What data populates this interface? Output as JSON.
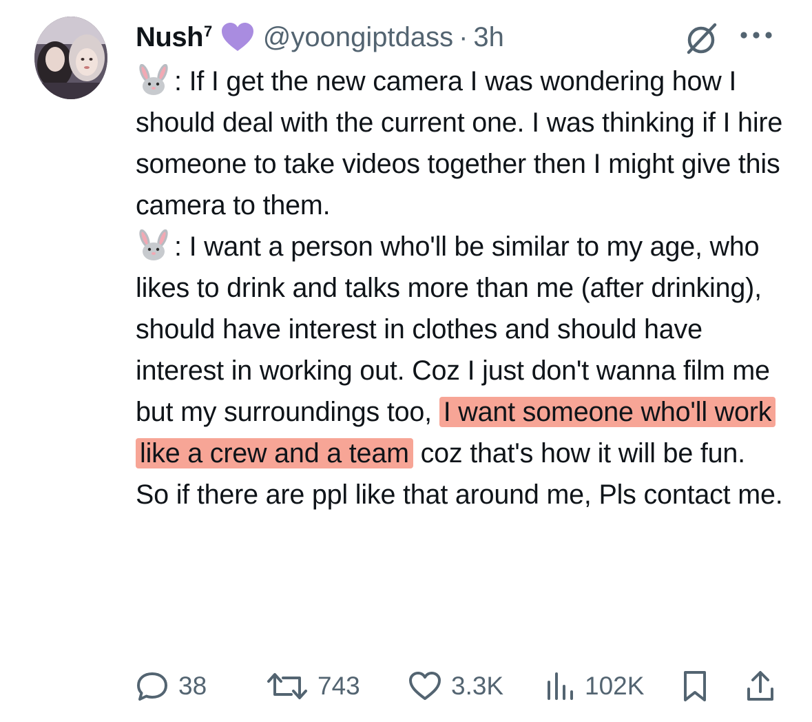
{
  "author": {
    "display_name": "Nush",
    "name_suffix": "7",
    "handle": "@yoongiptdass",
    "separator": "·",
    "time": "3h"
  },
  "icons": {
    "verified_badge": "purple-heart-icon",
    "grok": "grok-icon",
    "more": "more-icon",
    "speaker": "rabbit-face-emoji"
  },
  "body": {
    "p1": {
      "prefix": ": ",
      "text": "If I get the new camera I was wondering how I should deal with the current one. I was thinking if I hire someone to take videos together then I might give this camera to them."
    },
    "p2": {
      "prefix": ": ",
      "text_before": "I want a person who'll be similar to my age, who likes to drink and talks more than me (after drinking), should have interest in clothes and should have interest in working out. Coz I just don't wanna film me but my surroundings too, ",
      "highlight": "I want someone who'll work like a crew and a team",
      "text_after": " coz that's how it will be fun. So if there are ppl like that around me, Pls contact me."
    }
  },
  "actions": {
    "replies": "38",
    "reposts": "743",
    "likes": "3.3K",
    "views": "102K"
  },
  "colors": {
    "text": "#0f1419",
    "secondary": "#536471",
    "badge": "#a98ce0",
    "highlight": "#f7a596"
  }
}
